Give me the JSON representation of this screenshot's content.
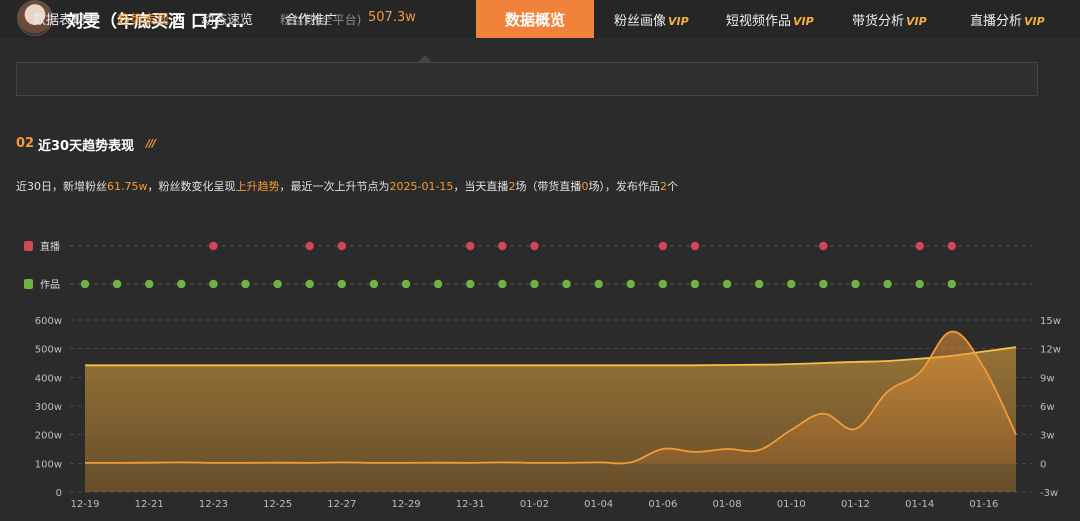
{
  "header": {
    "name": "刘雯（年底买酒 口子...",
    "fans_label": "粉丝数(全平台)",
    "fans_value": "507.3w",
    "active_tab": "数据概览",
    "tabs": [
      {
        "label": "粉丝画像",
        "vip": "VIP"
      },
      {
        "label": "短视频作品",
        "vip": "VIP"
      },
      {
        "label": "带货分析",
        "vip": "VIP"
      },
      {
        "label": "直播分析",
        "vip": "VIP"
      }
    ]
  },
  "subnav": {
    "items": [
      "数据表现",
      "趋势表现",
      "动态速览",
      "合作推广"
    ],
    "active_index": 1
  },
  "section": {
    "number": "02",
    "title": "近30天趋势表现",
    "deco": "///"
  },
  "summary": {
    "p1": "近30日，新增粉丝",
    "v1": "61.75w",
    "p2": "，粉丝数变化呈现",
    "v2": "上升趋势",
    "p3": "，最近一次上升节点为",
    "v3": "2025-01-15",
    "p4": "，当天直播",
    "v4": "2",
    "p5": "场（带货直播",
    "v5": "0",
    "p6": "场），发布作品",
    "v6": "2",
    "p7": "个"
  },
  "colors": {
    "accent": "#f0823a",
    "live_dot": "#d24656",
    "works_dot": "#6db347",
    "fans_line": "#f2c24a",
    "growth_line": "#f39a3a"
  },
  "chart_data": {
    "type": "area",
    "x": [
      "12-19",
      "12-20",
      "12-21",
      "12-22",
      "12-23",
      "12-24",
      "12-25",
      "12-26",
      "12-27",
      "12-28",
      "12-29",
      "12-30",
      "12-31",
      "01-01",
      "01-02",
      "01-03",
      "01-04",
      "01-05",
      "01-06",
      "01-07",
      "01-08",
      "01-09",
      "01-10",
      "01-11",
      "01-12",
      "01-13",
      "01-14",
      "01-15",
      "01-16",
      "01-17"
    ],
    "x_tick_labels": [
      "12-19",
      "12-21",
      "12-23",
      "12-25",
      "12-27",
      "12-29",
      "12-31",
      "01-02",
      "01-04",
      "01-06",
      "01-08",
      "01-10",
      "01-12",
      "01-14",
      "01-16"
    ],
    "y_left_ticks": [
      "0",
      "100w",
      "200w",
      "300w",
      "400w",
      "500w",
      "600w"
    ],
    "y_left_lim": [
      0,
      600
    ],
    "y_right_ticks": [
      "-3w",
      "0",
      "3w",
      "6w",
      "9w",
      "12w",
      "15w"
    ],
    "y_right_lim": [
      -3,
      15
    ],
    "rows": [
      {
        "label": "直播",
        "icon": "live-icon"
      },
      {
        "label": "作品",
        "icon": "works-icon"
      }
    ],
    "series": [
      {
        "axis": "left",
        "values": [
          442,
          442,
          442,
          442,
          442,
          442,
          442,
          442,
          442,
          442,
          442,
          442,
          442,
          442,
          442,
          442,
          442,
          442,
          442,
          442,
          443,
          444,
          446,
          450,
          454,
          457,
          465,
          475,
          490,
          505
        ]
      },
      {
        "axis": "right",
        "values": [
          0.05,
          0.05,
          0.07,
          0.1,
          0.05,
          0.05,
          0.07,
          0.05,
          0.1,
          0.05,
          0.05,
          0.07,
          0.05,
          0.1,
          0.05,
          0.05,
          0.1,
          0.1,
          1.5,
          1.2,
          1.5,
          1.4,
          3.5,
          5.2,
          3.6,
          7.5,
          9.5,
          13.8,
          10,
          3
        ]
      }
    ],
    "live_days": [
      "12-23",
      "12-26",
      "12-27",
      "12-31",
      "01-01",
      "01-02",
      "01-06",
      "01-07",
      "01-11",
      "01-14",
      "01-15"
    ],
    "works_days": [
      "12-19",
      "12-20",
      "12-21",
      "12-22",
      "12-23",
      "12-24",
      "12-25",
      "12-26",
      "12-27",
      "12-28",
      "12-29",
      "12-30",
      "12-31",
      "01-01",
      "01-02",
      "01-03",
      "01-04",
      "01-05",
      "01-06",
      "01-07",
      "01-08",
      "01-09",
      "01-10",
      "01-11",
      "01-12",
      "01-13",
      "01-14",
      "01-15"
    ]
  }
}
